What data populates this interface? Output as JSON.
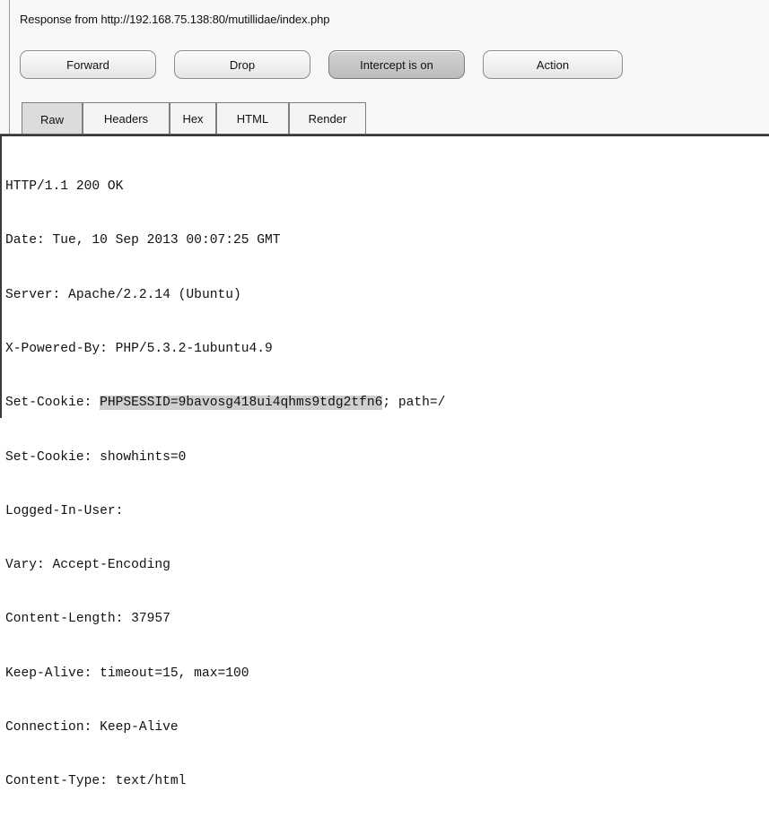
{
  "title": "Response from http://192.168.75.138:80/mutillidae/index.php",
  "buttons": {
    "forward": "Forward",
    "drop": "Drop",
    "intercept": "Intercept is on",
    "action": "Action"
  },
  "tabs": [
    "Raw",
    "Headers",
    "Hex",
    "HTML",
    "Render"
  ],
  "selected_tab": "Raw",
  "response_lines": [
    "HTTP/1.1 200 OK",
    "Date: Tue, 10 Sep 2013 00:07:25 GMT",
    "Server: Apache/2.2.14 (Ubuntu)",
    "X-Powered-By: PHP/5.3.2-1ubuntu4.9",
    "Set-Cookie: ",
    "Set-Cookie: showhints=0",
    "Logged-In-User:",
    "Vary: Accept-Encoding",
    "Content-Length: 37957",
    "Keep-Alive: timeout=15, max=100",
    "Connection: Keep-Alive",
    "Content-Type: text/html"
  ],
  "session_cookie": {
    "value": "PHPSESSID=9bavosg418ui4qhms9tdg2tfn6",
    "suffix": "; path=/"
  }
}
